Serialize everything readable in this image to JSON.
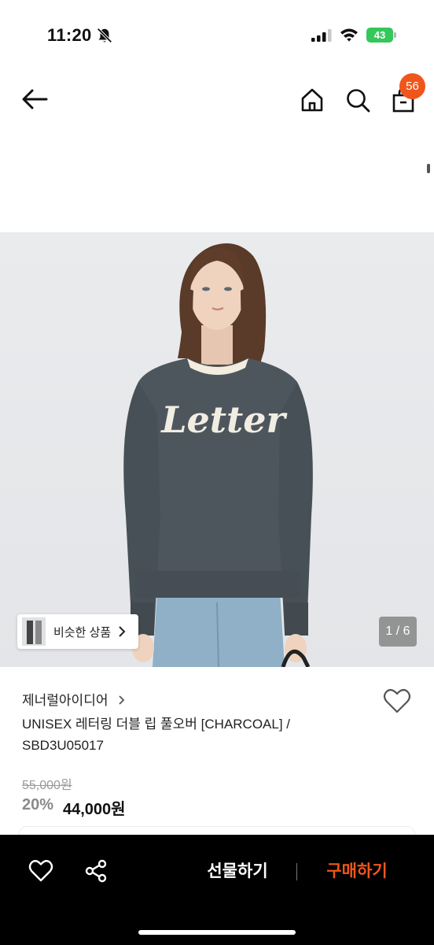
{
  "status_bar": {
    "time": "11:20",
    "battery": "43",
    "icons": [
      "bell-off-icon",
      "signal-icon",
      "wifi-icon",
      "battery-icon"
    ]
  },
  "nav": {
    "icons": [
      "back-arrow-icon",
      "home-icon",
      "search-icon",
      "shopping-bag-icon"
    ],
    "cart_count": "56"
  },
  "gallery": {
    "similar_label": "비슷한 상품",
    "page_counter": "1 / 6",
    "image_text": "Letter"
  },
  "product": {
    "brand": "제너럴아이디어",
    "title": "UNISEX 레터링 더블 립 풀오버 [CHARCOAL] / SBD3U05017",
    "original_price": "55,000원",
    "discount": "20%",
    "sale_price": "44,000원"
  },
  "bottom_bar": {
    "gift_label": "선물하기",
    "buy_label": "구매하기",
    "icons": [
      "heart-icon",
      "share-icon"
    ]
  },
  "colors": {
    "accent": "#f0561c",
    "battery_green": "#34c759",
    "bottom_bar_bg": "#000000"
  }
}
